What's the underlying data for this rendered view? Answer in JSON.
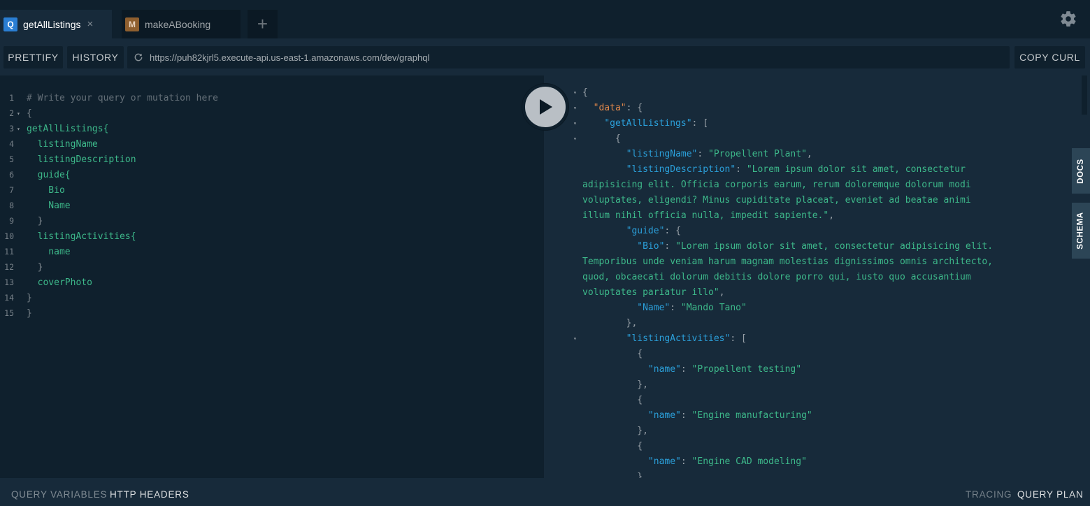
{
  "tabs": [
    {
      "badge": "Q",
      "label": "getAllListings",
      "active": true
    },
    {
      "badge": "M",
      "label": "makeABooking",
      "active": false
    }
  ],
  "icons": {
    "add": "plus-icon",
    "settings": "gear-icon",
    "reload": "reload-icon",
    "run": "play-icon",
    "fold": "caret-down-icon",
    "close": "close-icon"
  },
  "add_tab_symbol": "+",
  "close_symbol": "×",
  "fold_symbol": "▾",
  "toolbar": {
    "prettify": "PRETTIFY",
    "history": "HISTORY",
    "endpoint": "https://puh82kjrl5.execute-api.us-east-1.amazonaws.com/dev/graphql",
    "copy_curl": "COPY CURL"
  },
  "editor": {
    "lines": [
      {
        "n": "1",
        "fold": false,
        "text": "# Write your query or mutation here",
        "kind": "comment"
      },
      {
        "n": "2",
        "fold": true,
        "text": "{",
        "kind": "punc"
      },
      {
        "n": "3",
        "fold": true,
        "text": "getAllListings{",
        "kind": "field"
      },
      {
        "n": "4",
        "fold": false,
        "text": "  listingName",
        "kind": "field"
      },
      {
        "n": "5",
        "fold": false,
        "text": "  listingDescription",
        "kind": "field"
      },
      {
        "n": "6",
        "fold": false,
        "text": "  guide{",
        "kind": "field"
      },
      {
        "n": "7",
        "fold": false,
        "text": "    Bio",
        "kind": "field"
      },
      {
        "n": "8",
        "fold": false,
        "text": "    Name",
        "kind": "field"
      },
      {
        "n": "9",
        "fold": false,
        "text": "  }",
        "kind": "punc"
      },
      {
        "n": "10",
        "fold": false,
        "text": "  listingActivities{",
        "kind": "field"
      },
      {
        "n": "11",
        "fold": false,
        "text": "    name",
        "kind": "field"
      },
      {
        "n": "12",
        "fold": false,
        "text": "  }",
        "kind": "punc"
      },
      {
        "n": "13",
        "fold": false,
        "text": "  coverPhoto",
        "kind": "field"
      },
      {
        "n": "14",
        "fold": false,
        "text": "}",
        "kind": "punc"
      },
      {
        "n": "15",
        "fold": false,
        "text": "}",
        "kind": "punc"
      }
    ]
  },
  "result": {
    "lines": [
      {
        "fold": true,
        "parts": [
          [
            "p",
            "{"
          ]
        ]
      },
      {
        "fold": true,
        "parts": [
          [
            "p",
            "  "
          ],
          [
            "kd",
            "\"data\""
          ],
          [
            "p",
            ": {"
          ]
        ]
      },
      {
        "fold": true,
        "parts": [
          [
            "p",
            "    "
          ],
          [
            "k",
            "\"getAllListings\""
          ],
          [
            "p",
            ": ["
          ]
        ]
      },
      {
        "fold": true,
        "parts": [
          [
            "p",
            "      {"
          ]
        ]
      },
      {
        "fold": false,
        "parts": [
          [
            "p",
            "        "
          ],
          [
            "k",
            "\"listingName\""
          ],
          [
            "p",
            ": "
          ],
          [
            "s",
            "\"Propellent Plant\""
          ],
          [
            "p",
            ","
          ]
        ]
      },
      {
        "fold": false,
        "parts": [
          [
            "p",
            "        "
          ],
          [
            "k",
            "\"listingDescription\""
          ],
          [
            "p",
            ": "
          ],
          [
            "s",
            "\"Lorem ipsum dolor sit amet, consectetur"
          ]
        ]
      },
      {
        "fold": false,
        "parts": [
          [
            "s",
            "adipisicing elit. Officia corporis earum, rerum doloremque dolorum modi"
          ]
        ]
      },
      {
        "fold": false,
        "parts": [
          [
            "s",
            "voluptates, eligendi? Minus cupiditate placeat, eveniet ad beatae animi"
          ]
        ]
      },
      {
        "fold": false,
        "parts": [
          [
            "s",
            "illum nihil officia nulla, impedit sapiente.\""
          ],
          [
            "p",
            ","
          ]
        ]
      },
      {
        "fold": false,
        "parts": [
          [
            "p",
            "        "
          ],
          [
            "k",
            "\"guide\""
          ],
          [
            "p",
            ": {"
          ]
        ]
      },
      {
        "fold": false,
        "parts": [
          [
            "p",
            "          "
          ],
          [
            "k",
            "\"Bio\""
          ],
          [
            "p",
            ": "
          ],
          [
            "s",
            "\"Lorem ipsum dolor sit amet, consectetur adipisicing elit."
          ]
        ]
      },
      {
        "fold": false,
        "parts": [
          [
            "s",
            "Temporibus unde veniam harum magnam molestias dignissimos omnis architecto,"
          ]
        ]
      },
      {
        "fold": false,
        "parts": [
          [
            "s",
            "quod, obcaecati dolorum debitis dolore porro qui, iusto quo accusantium"
          ]
        ]
      },
      {
        "fold": false,
        "parts": [
          [
            "s",
            "voluptates pariatur illo\""
          ],
          [
            "p",
            ","
          ]
        ]
      },
      {
        "fold": false,
        "parts": [
          [
            "p",
            "          "
          ],
          [
            "k",
            "\"Name\""
          ],
          [
            "p",
            ": "
          ],
          [
            "s",
            "\"Mando Tano\""
          ]
        ]
      },
      {
        "fold": false,
        "parts": [
          [
            "p",
            "        },"
          ]
        ]
      },
      {
        "fold": true,
        "parts": [
          [
            "p",
            "        "
          ],
          [
            "k",
            "\"listingActivities\""
          ],
          [
            "p",
            ": ["
          ]
        ]
      },
      {
        "fold": false,
        "parts": [
          [
            "p",
            "          {"
          ]
        ]
      },
      {
        "fold": false,
        "parts": [
          [
            "p",
            "            "
          ],
          [
            "k",
            "\"name\""
          ],
          [
            "p",
            ": "
          ],
          [
            "s",
            "\"Propellent testing\""
          ]
        ]
      },
      {
        "fold": false,
        "parts": [
          [
            "p",
            "          },"
          ]
        ]
      },
      {
        "fold": false,
        "parts": [
          [
            "p",
            "          {"
          ]
        ]
      },
      {
        "fold": false,
        "parts": [
          [
            "p",
            "            "
          ],
          [
            "k",
            "\"name\""
          ],
          [
            "p",
            ": "
          ],
          [
            "s",
            "\"Engine manufacturing\""
          ]
        ]
      },
      {
        "fold": false,
        "parts": [
          [
            "p",
            "          },"
          ]
        ]
      },
      {
        "fold": false,
        "parts": [
          [
            "p",
            "          {"
          ]
        ]
      },
      {
        "fold": false,
        "parts": [
          [
            "p",
            "            "
          ],
          [
            "k",
            "\"name\""
          ],
          [
            "p",
            ": "
          ],
          [
            "s",
            "\"Engine CAD modeling\""
          ]
        ]
      },
      {
        "fold": false,
        "parts": [
          [
            "p",
            "          }"
          ]
        ]
      }
    ]
  },
  "side_tabs": {
    "docs": "DOCS",
    "schema": "SCHEMA"
  },
  "bottom": {
    "query_variables": "QUERY VARIABLES",
    "http_headers": "HTTP HEADERS",
    "tracing": "TRACING",
    "query_plan": "QUERY PLAN"
  },
  "colors": {
    "background": "#172a3a",
    "editor": "#0f202d",
    "key": "#2b9fd9",
    "string": "#3db88a",
    "data_key": "#e2884b"
  }
}
